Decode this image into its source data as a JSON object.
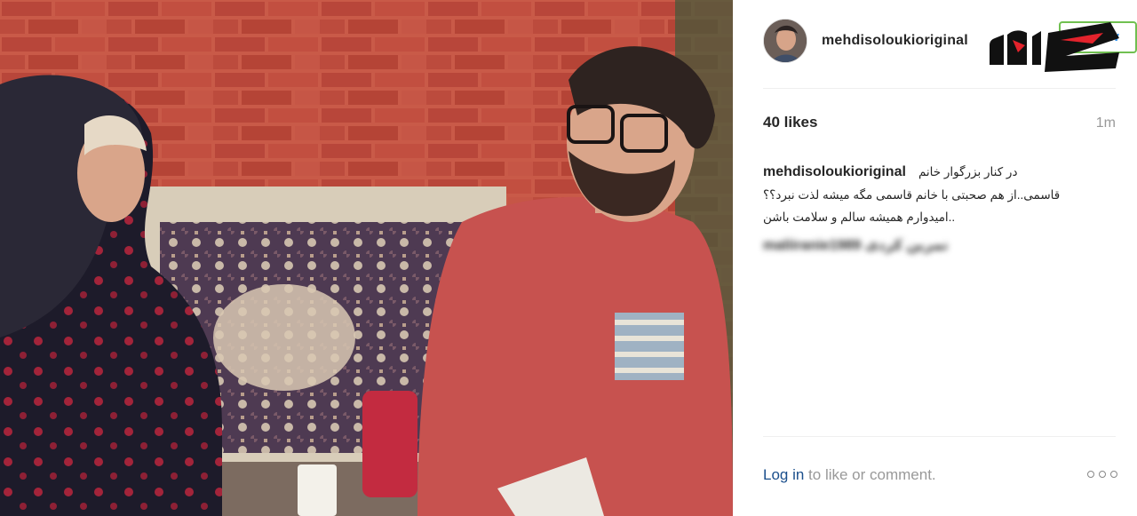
{
  "post": {
    "username": "mehdisoloukioriginal",
    "follow_label": "Follow",
    "likes": "40 likes",
    "time": "1m",
    "caption": {
      "username": "mehdisoloukioriginal",
      "line1": "در کنار بزرگوار خانم",
      "line2": "قاسمی..از هم صحبتی با خانم قاسمی مگه میشه لذت نبرد؟؟",
      "line3": "..امیدوارم همیشه سالم و سلامت باشن"
    },
    "blurred_comment": "maliiranie1989 تمرین کردی",
    "login_link": "Log in",
    "login_rest": " to like or comment."
  },
  "icons": {
    "more": "more-options-icon",
    "logo": "watermark-logo"
  },
  "colors": {
    "link_blue": "#3897f0",
    "login_blue": "#1b4f8c",
    "muted": "#999999",
    "logo_red": "#e3232c"
  }
}
